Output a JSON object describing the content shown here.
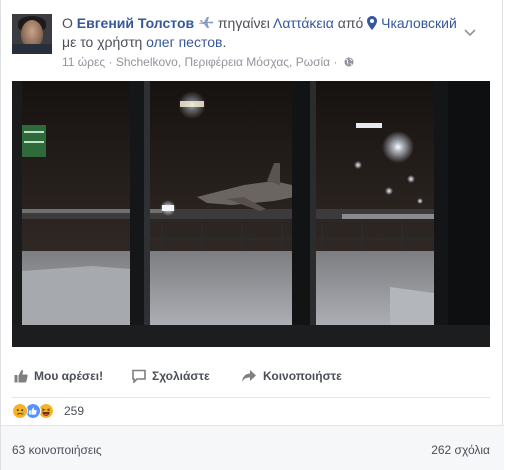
{
  "post": {
    "headline": {
      "prefix": "Ο",
      "author": "Евгений Толстов",
      "activity": "πηγαίνει",
      "destination": "Λαττάκεια",
      "from_word": "από",
      "origin": "Чкаловский",
      "with_text": "με το χρήστη",
      "tagged_user": "олег пестов",
      "end": "."
    },
    "meta": {
      "time": "11 ώρες",
      "separator": "·",
      "location": "Shchelkovo, Περιφέρεια Μόσχας, Ρωσία",
      "separator2": "·"
    }
  },
  "actions": {
    "like_label": "Μου αρέσει!",
    "comment_label": "Σχολιάστε",
    "share_label": "Κοινοποιήστε"
  },
  "reactions": {
    "count": "259",
    "icons": [
      "sad-icon",
      "like-icon",
      "haha-icon"
    ]
  },
  "stats": {
    "shares": "63 κοινοποιήσεις",
    "comments": "262 σχόλια"
  },
  "colors": {
    "link_blue": "#365899",
    "text_gray": "#4b4f56",
    "meta_gray": "#90949c",
    "like_blue": "#5890ff",
    "haha_yellow": "#f7b125"
  }
}
